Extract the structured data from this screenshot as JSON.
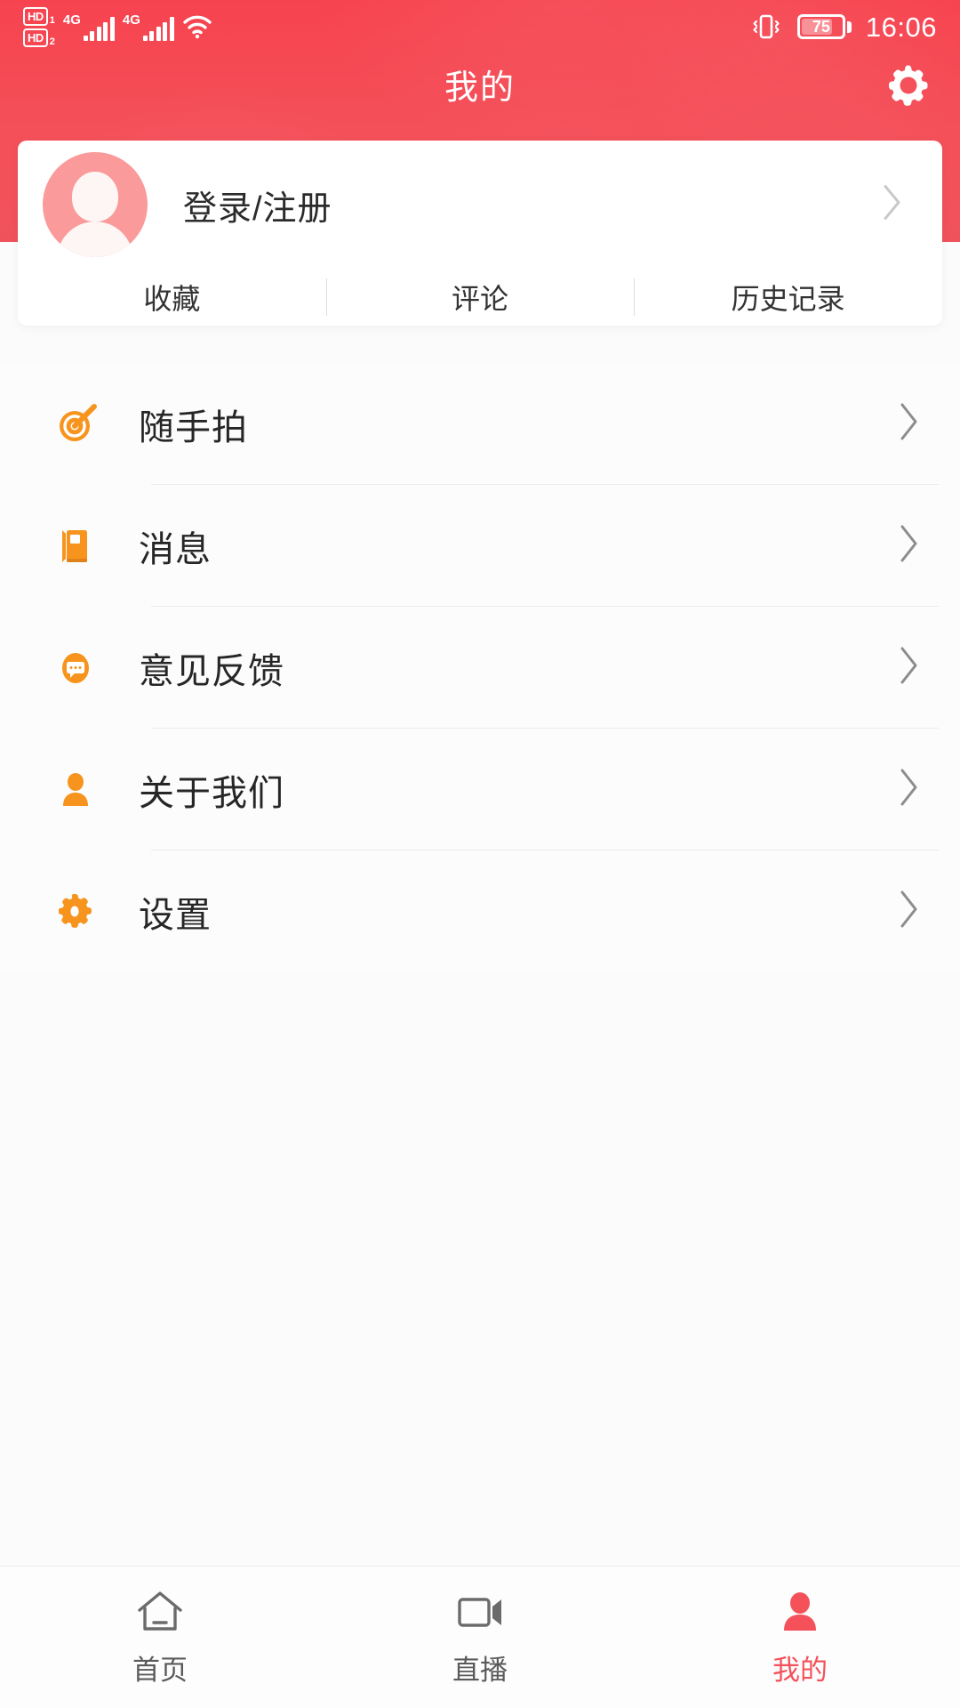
{
  "colors": {
    "header_red": "#f4515b",
    "accent_orange": "#f7941e",
    "active_tab_red": "#f4515b",
    "avatar_pink": "#fa9a9a",
    "text_dark": "#262626",
    "divider": "#ececec"
  },
  "statusbar": {
    "hd1_label": "HD",
    "hd1_sim": "1",
    "hd2_label": "HD",
    "hd2_sim": "2",
    "network1": "4G",
    "network2": "4G",
    "wifi_icon": "wifi-icon",
    "vibrate_icon": "vibrate-icon",
    "battery_percent": "75",
    "battery_level": 75,
    "time": "16:06"
  },
  "header": {
    "title": "我的",
    "settings_icon": "gear-icon"
  },
  "profile": {
    "avatar_icon": "avatar-placeholder-icon",
    "login_label": "登录/注册",
    "chevron_icon": "chevron-right-icon"
  },
  "tabs": [
    {
      "label": "收藏",
      "name": "tab-favorites"
    },
    {
      "label": "评论",
      "name": "tab-comments"
    },
    {
      "label": "历史记录",
      "name": "tab-history"
    }
  ],
  "menu": [
    {
      "label": "随手拍",
      "icon": "target-icon",
      "name": "menu-item-snapshot"
    },
    {
      "label": "消息",
      "icon": "book-icon",
      "name": "menu-item-messages"
    },
    {
      "label": "意见反馈",
      "icon": "chat-bubble-icon",
      "name": "menu-item-feedback"
    },
    {
      "label": "关于我们",
      "icon": "person-icon",
      "name": "menu-item-about-us"
    },
    {
      "label": "设置",
      "icon": "gear-icon",
      "name": "menu-item-settings"
    }
  ],
  "bottomnav": [
    {
      "label": "首页",
      "icon": "home-icon",
      "name": "nav-item-home",
      "active": false
    },
    {
      "label": "直播",
      "icon": "video-camera-icon",
      "name": "nav-item-live",
      "active": false
    },
    {
      "label": "我的",
      "icon": "person-filled-icon",
      "name": "nav-item-mine",
      "active": true
    }
  ]
}
